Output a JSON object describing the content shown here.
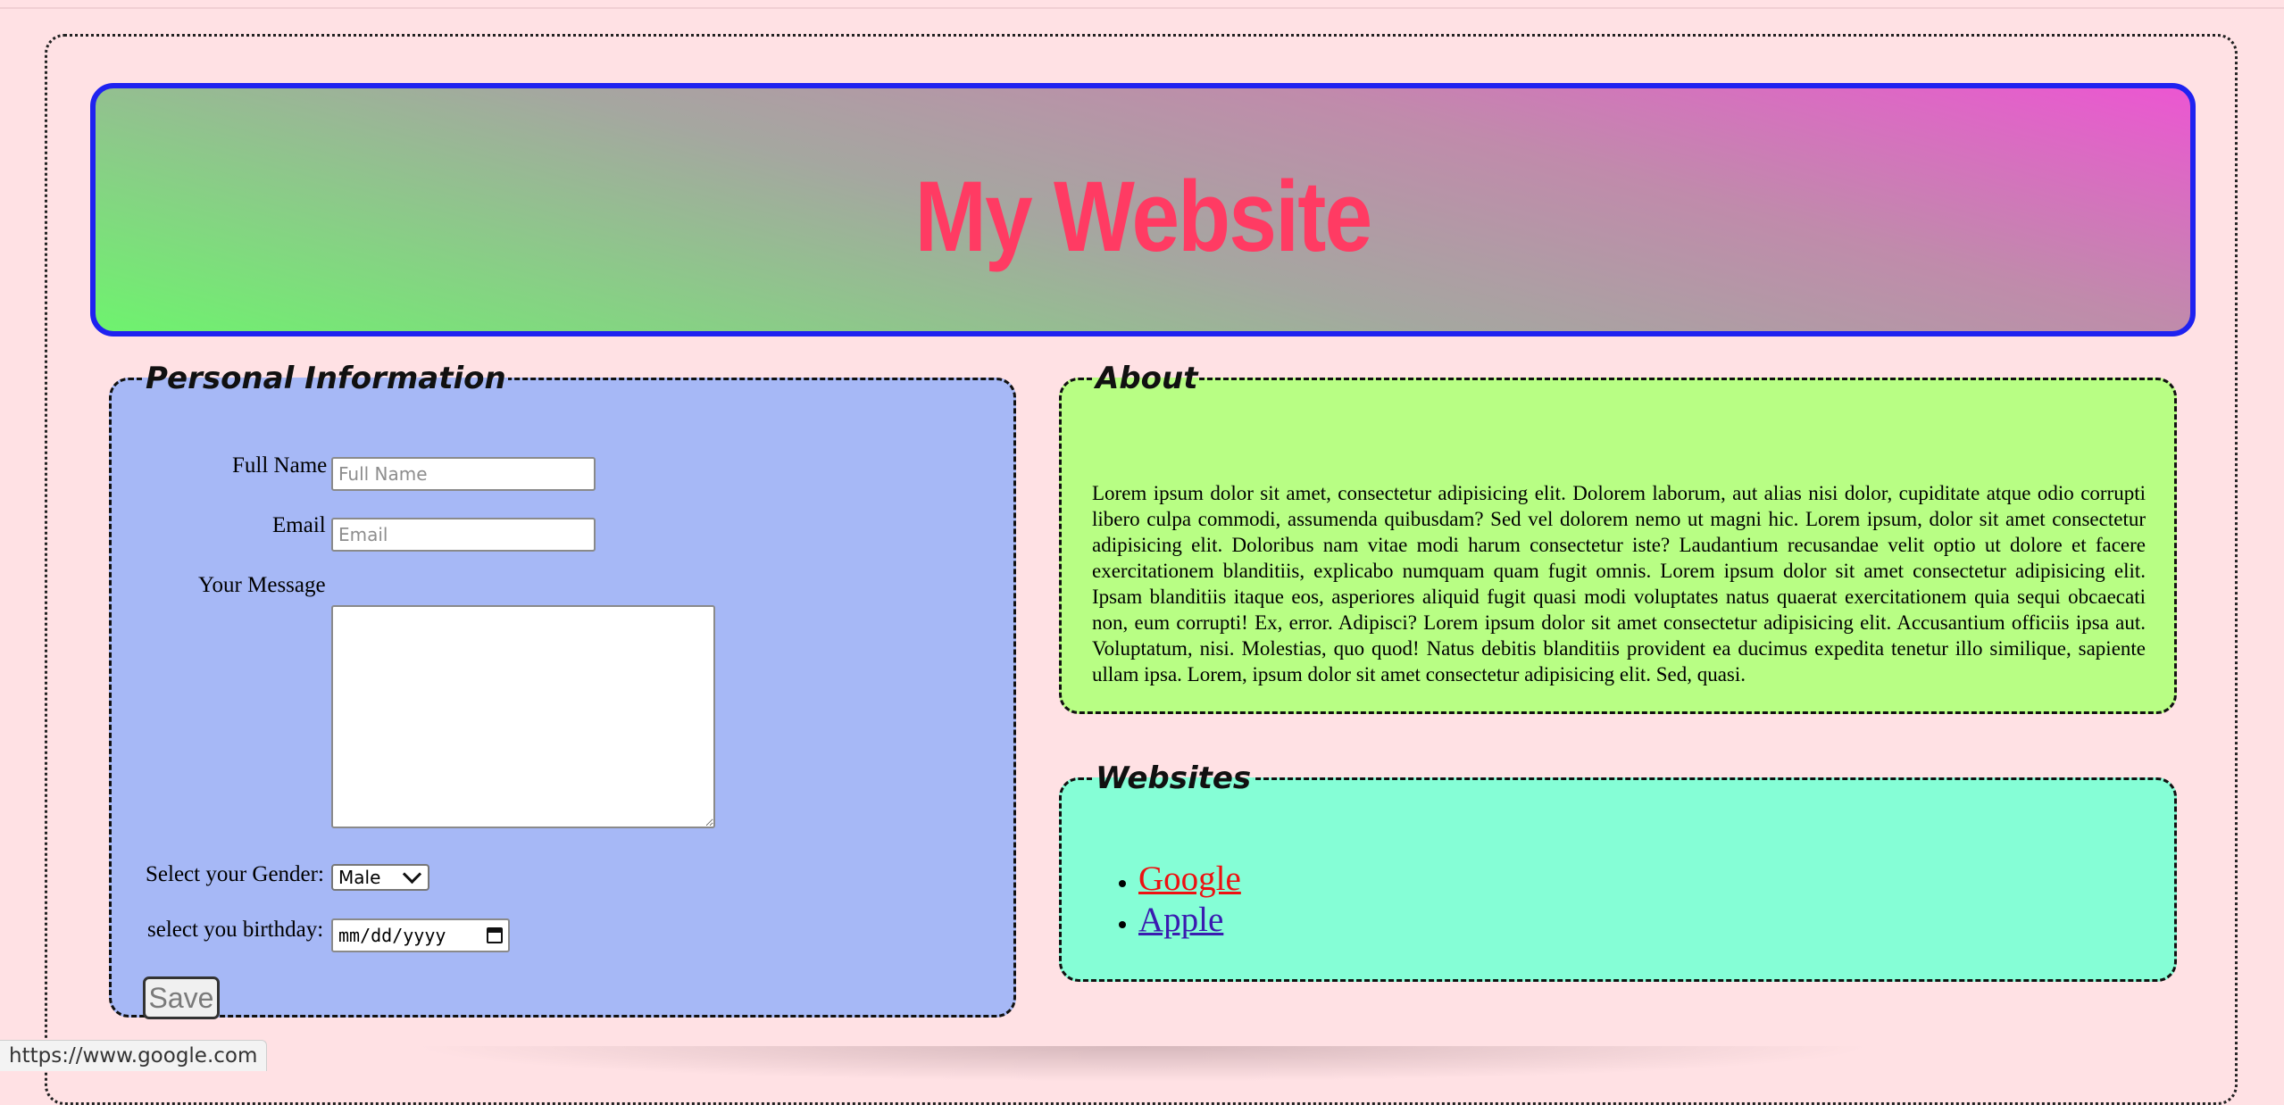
{
  "header": {
    "title": "My Website"
  },
  "personal": {
    "legend": "Personal Information",
    "full_name_label": "Full Name",
    "full_name_placeholder": "Full Name",
    "full_name_value": "",
    "email_label": "Email",
    "email_placeholder": "Email",
    "email_value": "",
    "message_label": "Your Message",
    "message_value": "",
    "gender_label": "Select your Gender:",
    "gender_selected": "Male",
    "birthday_label": "select you birthday:",
    "birthday_placeholder": "mm/dd/yyyy",
    "save_label": "Save"
  },
  "about": {
    "legend": "About",
    "text": "Lorem ipsum dolor sit amet, consectetur adipisicing elit. Dolorem laborum, aut alias nisi dolor, cupiditate atque odio corrupti libero culpa commodi, assumenda quibusdam? Sed vel dolorem nemo ut magni hic. Lorem ipsum, dolor sit amet consectetur adipisicing elit. Doloribus nam vitae modi harum consectetur iste? Laudantium recusandae velit optio ut dolore et facere exercitationem blanditiis, explicabo numquam quam fugit omnis. Lorem ipsum dolor sit amet consectetur adipisicing elit. Ipsam blanditiis itaque eos, asperiores aliquid fugit quasi modi voluptates natus quaerat exercitationem quia sequi obcaecati non, eum corrupti! Ex, error. Adipisci? Lorem ipsum dolor sit amet consectetur adipisicing elit. Accusantium officiis ipsa aut. Voluptatum, nisi. Molestias, quo quod! Natus debitis blanditiis provident ea ducimus expedita tenetur illo similique, sapiente ullam ipsa. Lorem, ipsum dolor sit amet consectetur adipisicing elit. Sed, quasi."
  },
  "websites": {
    "legend": "Websites",
    "links": [
      {
        "label": "Google",
        "color": "#ee1111"
      },
      {
        "label": "Apple",
        "color": "#3a1bb0"
      }
    ]
  },
  "status_bar": {
    "url": "https://www.google.com"
  },
  "colors": {
    "page_background": "#ffe1e4",
    "header_border": "#1f22f0",
    "title": "#ff3b63",
    "personal_panel": "#a6b8f6",
    "about_panel": "#b8fe84",
    "websites_panel": "#85fed6"
  }
}
